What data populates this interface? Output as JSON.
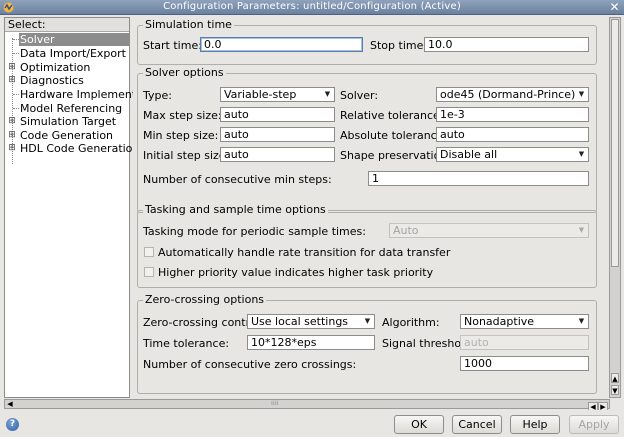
{
  "window": {
    "title": "Configuration Parameters: untitled/Configuration (Active)"
  },
  "tree": {
    "header": "Select:",
    "items": [
      {
        "label": "Solver",
        "selected": true,
        "expandable": false
      },
      {
        "label": "Data Import/Export",
        "selected": false,
        "expandable": false
      },
      {
        "label": "Optimization",
        "selected": false,
        "expandable": true
      },
      {
        "label": "Diagnostics",
        "selected": false,
        "expandable": true
      },
      {
        "label": "Hardware Implement...",
        "selected": false,
        "expandable": false
      },
      {
        "label": "Model Referencing",
        "selected": false,
        "expandable": false
      },
      {
        "label": "Simulation Target",
        "selected": false,
        "expandable": true
      },
      {
        "label": "Code Generation",
        "selected": false,
        "expandable": true
      },
      {
        "label": "HDL Code Generation",
        "selected": false,
        "expandable": true
      }
    ]
  },
  "simulation_time": {
    "title": "Simulation time",
    "start_label": "Start time:",
    "start_value": "0.0",
    "stop_label": "Stop time:",
    "stop_value": "10.0"
  },
  "solver_options": {
    "title": "Solver options",
    "type_label": "Type:",
    "type_value": "Variable-step",
    "solver_label": "Solver:",
    "solver_value": "ode45 (Dormand-Prince)",
    "max_step_label": "Max step size:",
    "max_step_value": "auto",
    "rel_tol_label": "Relative tolerance:",
    "rel_tol_value": "1e-3",
    "min_step_label": "Min step size:",
    "min_step_value": "auto",
    "abs_tol_label": "Absolute tolerance:",
    "abs_tol_value": "auto",
    "init_step_label": "Initial step size:",
    "init_step_value": "auto",
    "shape_label": "Shape preservation:",
    "shape_value": "Disable all",
    "consec_min_label": "Number of consecutive min steps:",
    "consec_min_value": "1"
  },
  "tasking": {
    "title": "Tasking and sample time options",
    "mode_label": "Tasking mode for periodic sample times:",
    "mode_value": "Auto",
    "auto_rate_label": "Automatically handle rate transition for data transfer",
    "auto_rate_checked": false,
    "priority_label": "Higher priority value indicates higher task priority",
    "priority_checked": false
  },
  "zero_crossing": {
    "title": "Zero-crossing options",
    "control_label": "Zero-crossing control:",
    "control_value": "Use local settings",
    "algorithm_label": "Algorithm:",
    "algorithm_value": "Nonadaptive",
    "time_tol_label": "Time tolerance:",
    "time_tol_value": "10*128*eps",
    "signal_thr_label": "Signal threshold:",
    "signal_thr_value": "auto",
    "consec_zc_label": "Number of consecutive zero crossings:",
    "consec_zc_value": "1000"
  },
  "buttons": {
    "ok": "OK",
    "cancel": "Cancel",
    "help": "Help",
    "apply": "Apply"
  },
  "icons": {
    "help": "help-icon",
    "close": "close-icon",
    "app": "simulink-icon"
  },
  "colors": {
    "titlebar": "#7a8fac",
    "selection": "#8c8c8c",
    "background": "#e8e6e2"
  }
}
